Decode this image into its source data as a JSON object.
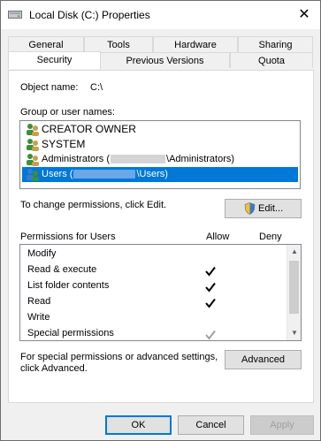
{
  "window": {
    "title": "Local Disk (C:) Properties",
    "close_glyph": "✕"
  },
  "tabs_row1": [
    "General",
    "Tools",
    "Hardware",
    "Sharing"
  ],
  "tabs_row2": [
    "Security",
    "Previous Versions",
    "Quota"
  ],
  "object_name_label": "Object name:",
  "object_name_value": "C:\\",
  "groups_label": "Group or user names:",
  "groups": [
    {
      "pre": "CREATOR OWNER",
      "post": ""
    },
    {
      "pre": "SYSTEM",
      "post": ""
    },
    {
      "pre": "Administrators (",
      "post": "\\Administrators)"
    },
    {
      "pre": "Users (",
      "post": "\\Users)"
    }
  ],
  "change_text": "To change permissions, click Edit.",
  "edit_button": "Edit...",
  "permissions_label": "Permissions for Users",
  "allow_header": "Allow",
  "deny_header": "Deny",
  "permissions": [
    {
      "name": "Modify",
      "allow": "none"
    },
    {
      "name": "Read & execute",
      "allow": "checked"
    },
    {
      "name": "List folder contents",
      "allow": "checked"
    },
    {
      "name": "Read",
      "allow": "checked"
    },
    {
      "name": "Write",
      "allow": "none"
    },
    {
      "name": "Special permissions",
      "allow": "inherited"
    }
  ],
  "special_text_line1": "For special permissions or advanced settings,",
  "special_text_line2": "click Advanced.",
  "advanced_button": "Advanced",
  "ok_button": "OK",
  "cancel_button": "Cancel",
  "apply_button": "Apply",
  "colors": {
    "selection": "#0078d7",
    "check": "#000000",
    "check_inherited": "#a0a0a0"
  }
}
